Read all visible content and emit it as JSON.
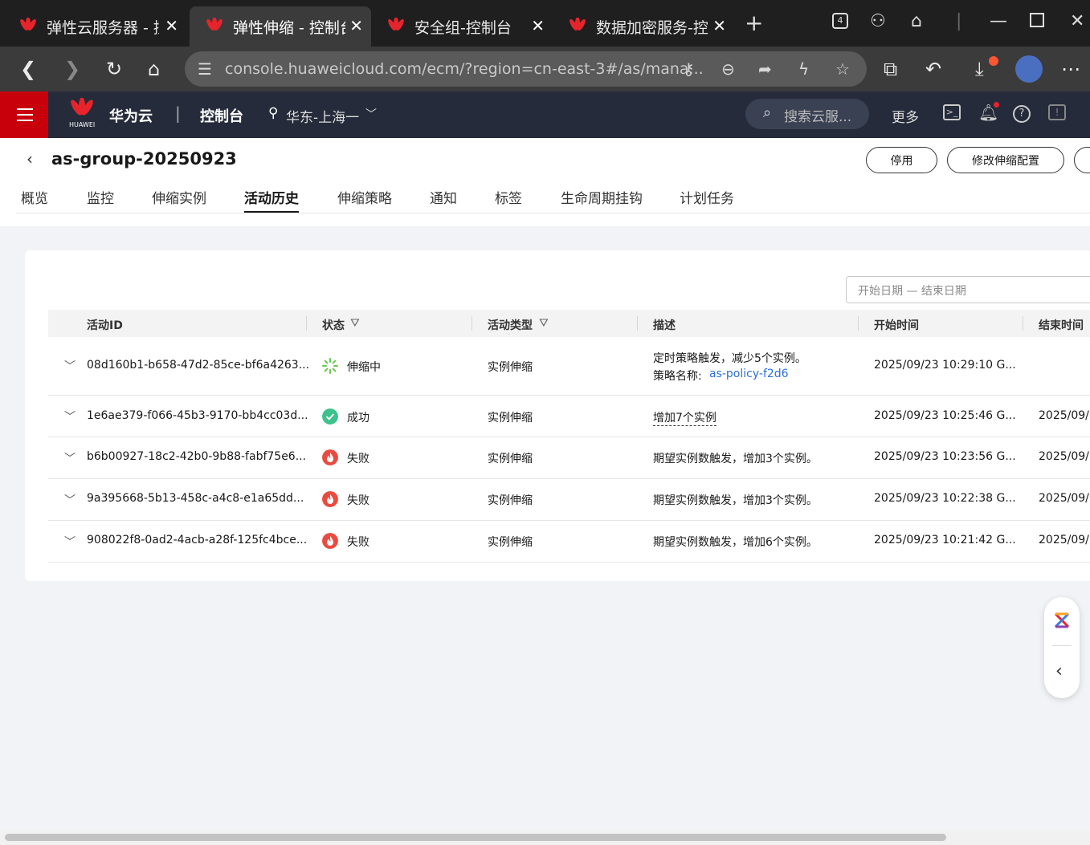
{
  "browser": {
    "tabs": [
      {
        "title": "弹性云服务器 - 控制台",
        "active": false
      },
      {
        "title": "弹性伸缩 - 控制台",
        "active": true
      },
      {
        "title": "安全组-控制台",
        "active": false
      },
      {
        "title": "数据加密服务-控制台",
        "active": false
      }
    ],
    "tab_count_badge": "4",
    "url": "console.huaweicloud.com/ecm/?region=cn-east-3#/as/mana..."
  },
  "console": {
    "brand": "华为云",
    "brand_sub": "HUAWEI",
    "console_label": "控制台",
    "region": "华东-上海一",
    "search_placeholder": "搜索云服...",
    "more_label": "更多"
  },
  "page": {
    "title": "as-group-20250923",
    "buttons": {
      "disable": "停用",
      "modify": "修改伸缩配置"
    },
    "tabs": [
      "概览",
      "监控",
      "伸缩实例",
      "活动历史",
      "伸缩策略",
      "通知",
      "标签",
      "生命周期挂钩",
      "计划任务"
    ],
    "active_tab": "活动历史",
    "date_placeholder": "开始日期 — 结束日期",
    "columns": [
      "活动ID",
      "状态",
      "活动类型",
      "描述",
      "开始时间",
      "结束时间"
    ],
    "rows": [
      {
        "id": "08d160b1-b658-47d2-85ce-bf6a4263...",
        "status": "伸缩中",
        "status_kind": "running",
        "type": "实例伸缩",
        "desc": "定时策略触发，减少5个实例。",
        "desc2_label": "策略名称:",
        "desc2_link": "as-policy-f2d6",
        "start": "2025/09/23 10:29:10 G...",
        "end": ""
      },
      {
        "id": "1e6ae379-f066-45b3-9170-bb4cc03d...",
        "status": "成功",
        "status_kind": "success",
        "type": "实例伸缩",
        "desc": "增加7个实例",
        "desc2_label": "",
        "desc2_link": "",
        "start": "2025/09/23 10:25:46 G...",
        "end": "2025/09/"
      },
      {
        "id": "b6b00927-18c2-42b0-9b88-fabf75e6...",
        "status": "失败",
        "status_kind": "fail",
        "type": "实例伸缩",
        "desc": "期望实例数触发，增加3个实例。",
        "desc2_label": "",
        "desc2_link": "",
        "start": "2025/09/23 10:23:56 G...",
        "end": "2025/09/"
      },
      {
        "id": "9a395668-5b13-458c-a4c8-e1a65dd...",
        "status": "失败",
        "status_kind": "fail",
        "type": "实例伸缩",
        "desc": "期望实例数触发，增加3个实例。",
        "desc2_label": "",
        "desc2_link": "",
        "start": "2025/09/23 10:22:38 G...",
        "end": "2025/09/"
      },
      {
        "id": "908022f8-0ad2-4acb-a28f-125fc4bce...",
        "status": "失败",
        "status_kind": "fail",
        "type": "实例伸缩",
        "desc": "期望实例数触发，增加6个实例。",
        "desc2_label": "",
        "desc2_link": "",
        "start": "2025/09/23 10:21:42 G...",
        "end": "2025/09/"
      }
    ]
  },
  "colors": {
    "brand_red": "#c7000b",
    "link_blue": "#2d6fd8",
    "success_green": "#3cc28a",
    "fail_red": "#ea4b3f",
    "running_green": "#68c94e"
  }
}
